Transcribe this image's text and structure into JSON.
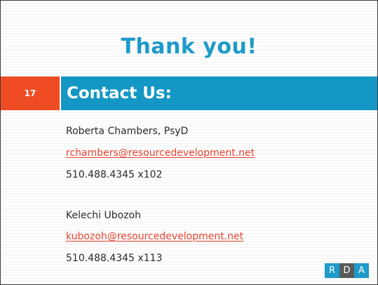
{
  "slide": {
    "number": "17",
    "title": "Thank you!",
    "header": "Contact Us:"
  },
  "contacts": [
    {
      "name": "Roberta Chambers, PsyD",
      "email": "rchambers@resourcedevelopment.net",
      "phone": "510.488.4345 x102"
    },
    {
      "name": "Kelechi Ubozoh",
      "email": "kubozoh@resourcedevelopment.net",
      "phone": "510.488.4345 x113"
    }
  ],
  "logo": {
    "letters": [
      "R",
      "D",
      "A"
    ],
    "colors": [
      "#1e9bc9",
      "#5a5a5a",
      "#1e9bc9"
    ]
  },
  "colors": {
    "accent_blue": "#1497c4",
    "accent_orange": "#ef4c23",
    "link_red": "#e8432f"
  }
}
